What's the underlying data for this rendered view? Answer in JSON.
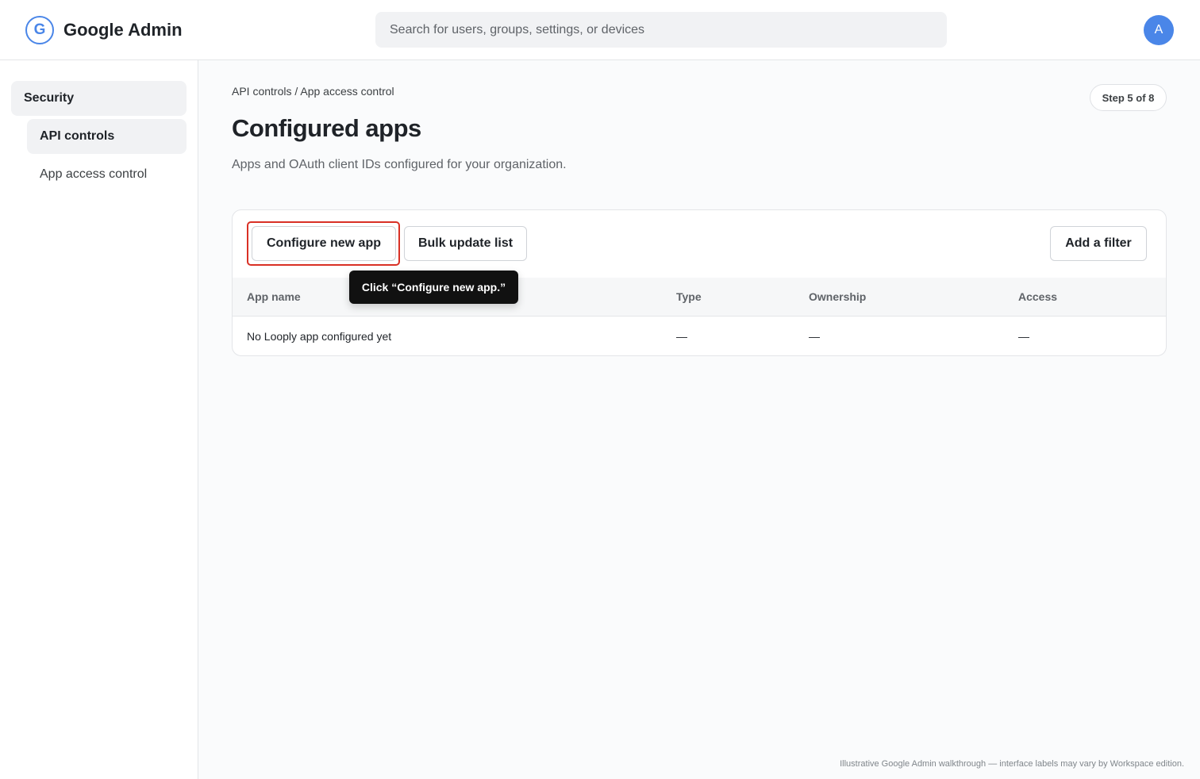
{
  "header": {
    "logo_letter": "G",
    "logo_icon": "google-g-icon",
    "app_title": "Google Admin",
    "search_placeholder": "Search for users, groups, settings, or devices",
    "avatar_letter": "A",
    "accent_color": "#4a86e8"
  },
  "sidebar": {
    "section_label": "Security",
    "items": [
      {
        "label": "API controls",
        "active": true
      },
      {
        "label": "App access control",
        "active": false
      }
    ]
  },
  "main": {
    "breadcrumb": "API controls / App access control",
    "step_badge": "Step 5 of 8",
    "title": "Configured apps",
    "subtitle": "Apps and OAuth client IDs configured for your organization.",
    "toolbar": {
      "configure_label": "Configure new app",
      "bulk_label": "Bulk update list",
      "filter_label": "Add a filter"
    },
    "tooltip": "Click “Configure new app.”",
    "highlight_color": "#d93025",
    "table": {
      "columns": [
        "App name",
        "Type",
        "Ownership",
        "Access"
      ],
      "rows": [
        [
          "No Looply app configured yet",
          "—",
          "—",
          "—"
        ]
      ]
    }
  },
  "footer_note": "Illustrative Google Admin walkthrough — interface labels may vary by Workspace edition."
}
